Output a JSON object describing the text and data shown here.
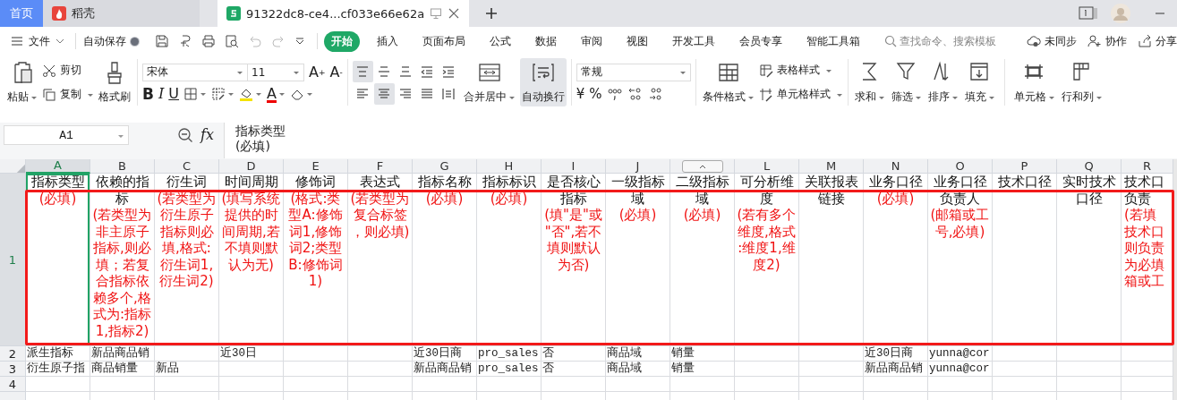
{
  "title_bar": {
    "tabs": [
      {
        "label": "首页",
        "kind": "home",
        "selected": false
      },
      {
        "label": "稻壳",
        "kind": "docer",
        "selected": false
      },
      {
        "label": "91322dc8-ce4...cf033e66e62a",
        "kind": "sheet",
        "selected": true
      }
    ]
  },
  "menu_bar": {
    "file_label": "文件",
    "autosave": {
      "label": "自动保存",
      "on": false
    },
    "tabs": [
      {
        "label": "开始",
        "selected": true
      },
      {
        "label": "插入",
        "selected": false
      },
      {
        "label": "页面布局",
        "selected": false
      },
      {
        "label": "公式",
        "selected": false
      },
      {
        "label": "数据",
        "selected": false
      },
      {
        "label": "审阅",
        "selected": false
      },
      {
        "label": "视图",
        "selected": false
      },
      {
        "label": "开发工具",
        "selected": false
      },
      {
        "label": "会员专享",
        "selected": false
      },
      {
        "label": "智能工具箱",
        "selected": false
      }
    ],
    "search": {
      "placeholder": "查找命令、搜索模板"
    },
    "actions": [
      {
        "label": "未同步",
        "kind": "cloud"
      },
      {
        "label": "协作",
        "kind": "user"
      },
      {
        "label": "分享",
        "kind": "share"
      }
    ]
  },
  "ribbon": {
    "clipboard": {
      "paste": "粘贴",
      "cut": "剪切",
      "copy": "复制",
      "format_painter": "格式刷"
    },
    "font": {
      "family": "宋体",
      "size": "11",
      "grow": {
        "letter": "A",
        "sign": "+"
      },
      "shrink": {
        "letter": "A",
        "sign": "-"
      },
      "styles": [
        "B",
        "I",
        "U"
      ],
      "color_letter": "A"
    },
    "alignment": [
      {
        "kind": "top",
        "selected": true
      },
      {
        "kind": "middle",
        "selected": false
      },
      {
        "kind": "bottom",
        "selected": false
      },
      {
        "kind": "outdent",
        "selected": false
      },
      {
        "kind": "indent",
        "selected": false
      },
      {
        "kind": "left",
        "selected": false
      },
      {
        "kind": "center",
        "selected": true
      },
      {
        "kind": "right",
        "selected": false
      },
      {
        "kind": "justify",
        "selected": false
      },
      {
        "kind": "distribute",
        "selected": false
      }
    ],
    "merge": "合并居中",
    "wrap": {
      "label": "自动换行",
      "on": true
    },
    "number": {
      "format": "常规",
      "symbols": [
        "¥",
        "%"
      ]
    },
    "styles": {
      "conditional": "条件格式",
      "table_style": "表格样式",
      "cell_style": "单元格样式"
    },
    "editing": [
      {
        "label": "求和",
        "kind": "sum"
      },
      {
        "label": "筛选",
        "kind": "filter"
      },
      {
        "label": "排序",
        "kind": "sort"
      },
      {
        "label": "填充",
        "kind": "fill"
      },
      {
        "label": "单元格",
        "kind": "cell"
      },
      {
        "label": "行和列",
        "kind": "rowcol"
      }
    ]
  },
  "formula_bar": {
    "name_box": "A1",
    "fx_label": "fx",
    "formula": "指标类型\n(必填)"
  },
  "sheet": {
    "columns": [
      {
        "label": "A",
        "kind": "letter",
        "selected": true
      },
      {
        "label": "B",
        "kind": "letter",
        "selected": false
      },
      {
        "label": "C",
        "kind": "letter",
        "selected": false
      },
      {
        "label": "D",
        "kind": "letter",
        "selected": false
      },
      {
        "label": "E",
        "kind": "letter",
        "selected": false
      },
      {
        "label": "F",
        "kind": "letter",
        "selected": false
      },
      {
        "label": "G",
        "kind": "letter",
        "selected": false
      },
      {
        "label": "H",
        "kind": "letter",
        "selected": false
      },
      {
        "label": "I",
        "kind": "letter",
        "selected": false
      },
      {
        "label": "J",
        "kind": "letter",
        "selected": false
      },
      {
        "kind": "collapse",
        "selected": false
      },
      {
        "label": "L",
        "kind": "letter",
        "selected": false
      },
      {
        "label": "M",
        "kind": "letter",
        "selected": false
      },
      {
        "label": "N",
        "kind": "letter",
        "selected": false
      },
      {
        "label": "O",
        "kind": "letter",
        "selected": false
      },
      {
        "label": "P",
        "kind": "letter",
        "selected": false
      },
      {
        "label": "Q",
        "kind": "letter",
        "selected": false
      },
      {
        "label": "R",
        "kind": "letter",
        "selected": false
      }
    ],
    "header_row": {
      "number": "1",
      "selected": true,
      "cells": [
        {
          "title": "指标类型",
          "note": "(必填)"
        },
        {
          "title": "依赖的指标",
          "note": "(若类型为非主原子指标,则必填；若复合指标依赖多个,格式为:指标1,指标2)"
        },
        {
          "title": "衍生词",
          "note": "(若类型为衍生原子指标则必填,格式:衍生词1,衍生词2)"
        },
        {
          "title": "时间周期",
          "note": "(填写系统提供的时间周期,若不填则默认为无)"
        },
        {
          "title": "修饰词",
          "note": "(格式:类型A:修饰词1,修饰词2;类型B:修饰词1)"
        },
        {
          "title": "表达式",
          "note": "(若类型为复合标签，则必填)"
        },
        {
          "title": "指标名称",
          "note": "(必填)"
        },
        {
          "title": "指标标识",
          "note": "(必填)"
        },
        {
          "title": "是否核心指标",
          "note": "(填\"是\"或\"否\",若不填则默认为否)"
        },
        {
          "title": "一级指标域",
          "note": "(必填)"
        },
        {
          "title": "二级指标域",
          "note": "(必填)"
        },
        {
          "title": "可分析维度",
          "note": "(若有多个维度,格式:维度1,维度2)"
        },
        {
          "title": "关联报表链接"
        },
        {
          "title": "业务口径",
          "note": "(必填)"
        },
        {
          "title": "业务口径负责人",
          "note": "(邮箱或工号,必填)"
        },
        {
          "title": "技术口径"
        },
        {
          "title": "实时技术口径"
        },
        {
          "title": "技术口负责",
          "note": "(若填技术口则负责为必填箱或工",
          "kind": "cut"
        }
      ]
    },
    "rows": [
      {
        "number": "2",
        "selected": false,
        "cells": [
          "派生指标",
          "新品商品销",
          null,
          "近30日",
          null,
          null,
          "近30日商",
          "pro_sales",
          "否",
          "商品域",
          "销量",
          null,
          null,
          "近30日商",
          "yunna@cor",
          null,
          null,
          null
        ]
      },
      {
        "number": "3",
        "selected": false,
        "cells": [
          "衍生原子指",
          "商品销量",
          "新品",
          null,
          null,
          null,
          "新品商品销",
          "pro_sales",
          "否",
          "商品域",
          "销量",
          null,
          null,
          "新品商品销",
          "yunna@cor",
          null,
          null,
          null
        ]
      },
      {
        "number": "4",
        "selected": false,
        "cells": [
          null,
          null,
          null,
          null,
          null,
          null,
          null,
          null,
          null,
          null,
          null,
          null,
          null,
          null,
          null,
          null,
          null,
          null
        ]
      }
    ]
  }
}
